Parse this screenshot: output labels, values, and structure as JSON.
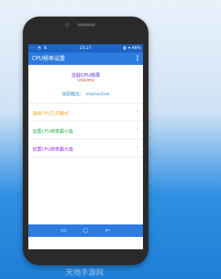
{
  "status": {
    "left_icons": "⋯ ◔ ⇅",
    "time": "23:27",
    "right_icons": "◐ ▾ 46%"
  },
  "app": {
    "title": "CPU频率设置",
    "current_freq_label": "当前CPU频率",
    "current_freq_value": "1094 MHz",
    "mode_text": "当前模式： interactive"
  },
  "menu": [
    {
      "label": "选择CPU工作模式",
      "color": "#e8a21f"
    },
    {
      "label": "设置CPU频率最小值",
      "color": "#2aa94f"
    },
    {
      "label": "设置CPU频率最大值",
      "color": "#9b2bd6"
    }
  ],
  "watermark": "天地手游网",
  "colors": {
    "statusbar": "#1e63c6",
    "appbar": "#2c7be0",
    "accent_purple": "#5a2fd6",
    "accent_red": "#e23b3b",
    "accent_blue": "#2a8fd6"
  },
  "icons": {
    "menu": "overflow-menu-icon",
    "chevron": "chevron-right-icon",
    "nav": [
      "recents-icon",
      "home-icon",
      "back-icon"
    ]
  }
}
